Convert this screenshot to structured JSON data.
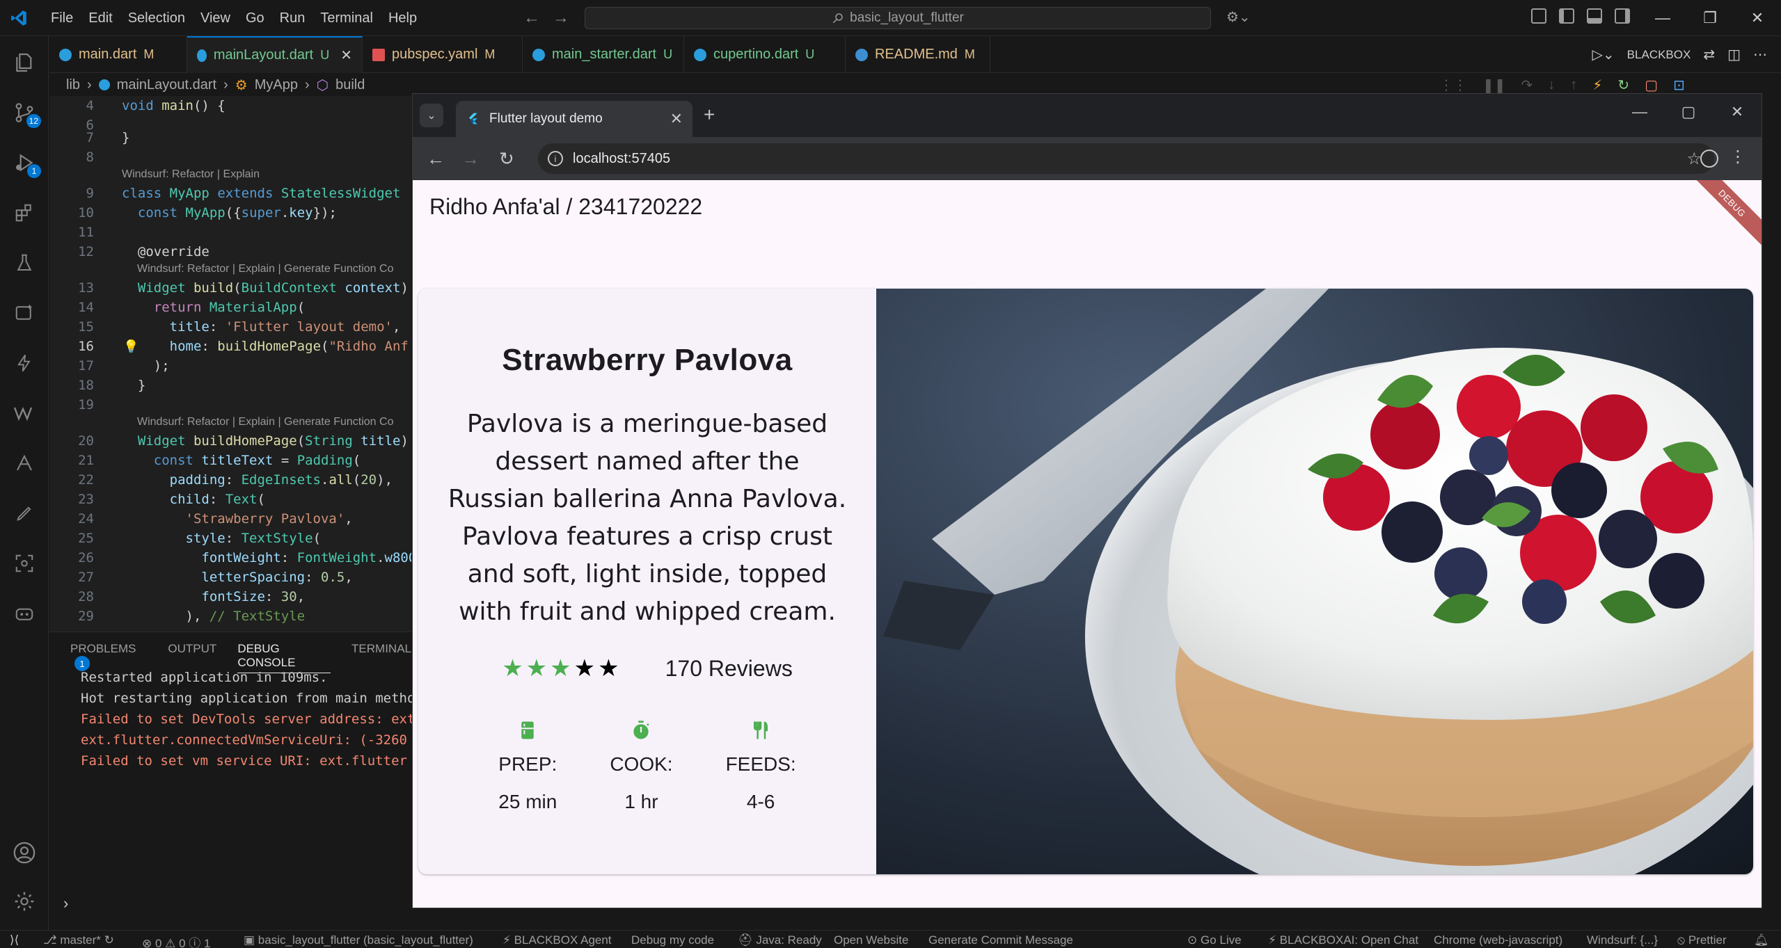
{
  "titlebar": {
    "menu": [
      "File",
      "Edit",
      "Selection",
      "View",
      "Go",
      "Run",
      "Terminal",
      "Help"
    ],
    "search_text": "basic_layout_flutter"
  },
  "activity_badges": {
    "source_control": "12",
    "run_debug": "1"
  },
  "tabs": [
    {
      "name": "main.dart",
      "status": "M",
      "color": "#e2c08d",
      "icon_color": "#2a9ddc"
    },
    {
      "name": "mainLayout.dart",
      "status": "U",
      "color": "#73c991",
      "icon_color": "#2a9ddc",
      "active": true
    },
    {
      "name": "pubspec.yaml",
      "status": "M",
      "color": "#e2c08d",
      "icon_color": "#e05252"
    },
    {
      "name": "main_starter.dart",
      "status": "U",
      "color": "#73c991",
      "icon_color": "#2a9ddc"
    },
    {
      "name": "cupertino.dart",
      "status": "U",
      "color": "#73c991",
      "icon_color": "#2a9ddc"
    },
    {
      "name": "README.md",
      "status": "M",
      "color": "#e2c08d",
      "icon_color": "#3d8fd1"
    }
  ],
  "tabbar_right": {
    "blackbox_label": "BLACKBOX"
  },
  "breadcrumb": {
    "folder": "lib",
    "file": "mainLayout.dart",
    "class": "MyApp",
    "method": "build"
  },
  "editor": {
    "codelens_refactor": "Windsurf: Refactor | Explain",
    "codelens_full": "Windsurf: Refactor | Explain | Generate Function Co",
    "line_numbers": [
      "4",
      "6",
      "7",
      "8",
      "9",
      "10",
      "11",
      "12",
      "13",
      "14",
      "15",
      "16",
      "17",
      "18",
      "19",
      "20",
      "21",
      "22",
      "23",
      "24",
      "25",
      "26",
      "27",
      "28",
      "29"
    ]
  },
  "panel": {
    "tabs": [
      "PROBLEMS",
      "OUTPUT",
      "DEBUG CONSOLE",
      "TERMINAL"
    ],
    "problems_count": "1",
    "log": [
      {
        "text": "Restarted application in 109ms.",
        "color": "#cccccc"
      },
      {
        "text": "Hot restarting application from main metho",
        "color": "#cccccc"
      },
      {
        "text": "Failed to set DevTools server address: ext",
        "color": "#f48771"
      },
      {
        "text": "ext.flutter.connectedVmServiceUri: (-3260",
        "color": "#f48771"
      },
      {
        "text": "Failed to set vm service URI: ext.flutter",
        "color": "#f48771"
      }
    ]
  },
  "statusbar": {
    "branch": "master*",
    "problems": "⊗ 0 ⚠ 0 ⓘ 1",
    "project": "basic_layout_flutter (basic_layout_flutter)",
    "blackbox_agent": "BLACKBOX Agent",
    "debug_code": "Debug my code",
    "java": "Java: Ready",
    "open_website": "Open Website",
    "commit": "Generate Commit Message",
    "go_live": "Go Live",
    "blackbox_chat": "BLACKBOXAI: Open Chat",
    "chrome": "Chrome (web-javascript)",
    "windsurf": "Windsurf: {...}",
    "prettier": "Prettier"
  },
  "browser": {
    "tab_title": "Flutter layout demo",
    "url": "localhost:57405"
  },
  "app": {
    "header": "Ridho Anfa'al / 2341720222",
    "debug_banner": "DEBUG",
    "title": "Strawberry Pavlova",
    "description": "Pavlova is a meringue-based dessert named after the Russian ballerina Anna Pavlova. Pavlova features a crisp crust and soft, light inside, topped with fruit and whipped cream.",
    "rating": 3,
    "rating_max": 5,
    "reviews": "170 Reviews",
    "stats": [
      {
        "icon": "kitchen-icon",
        "label": "PREP:",
        "value": "25 min"
      },
      {
        "icon": "timer-icon",
        "label": "COOK:",
        "value": "1 hr"
      },
      {
        "icon": "restaurant-icon",
        "label": "FEEDS:",
        "value": "4-6"
      }
    ],
    "accent_color": "#4caf50"
  }
}
